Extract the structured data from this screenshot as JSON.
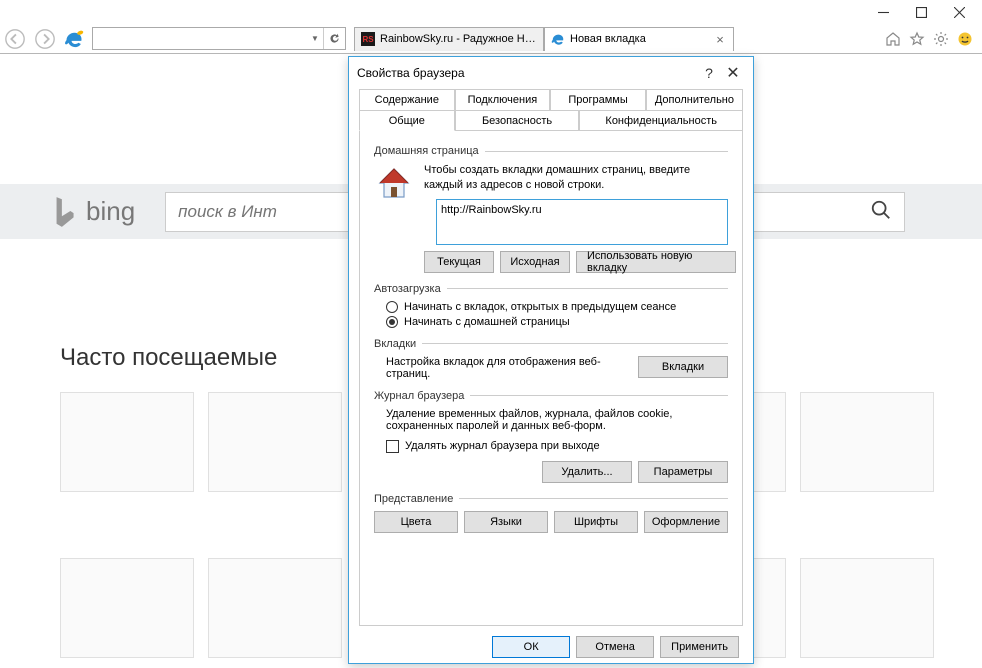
{
  "window": {
    "minimize": "",
    "maximize": "",
    "close": ""
  },
  "tabs": [
    {
      "label": "RainbowSky.ru - Радужное Не…",
      "type": "rs"
    },
    {
      "label": "Новая вкладка",
      "type": "ie"
    }
  ],
  "toolbar_icons": [
    "home",
    "star",
    "gear",
    "smiley"
  ],
  "page": {
    "bing_label": "bing",
    "search_placeholder": "поиск в Инт",
    "frequent_heading": "Часто посещаемые"
  },
  "dialog": {
    "title": "Свойства браузера",
    "help": "?",
    "close": "✕",
    "tabs_row1": [
      "Содержание",
      "Подключения",
      "Программы",
      "Дополнительно"
    ],
    "tabs_row2": [
      "Общие",
      "Безопасность",
      "Конфиденциальность"
    ],
    "active_tab": "Общие",
    "homepage": {
      "title": "Домашняя страница",
      "desc": "Чтобы создать вкладки домашних страниц, введите каждый из адресов с новой строки.",
      "value": "http://RainbowSky.ru",
      "btn_current": "Текущая",
      "btn_default": "Исходная",
      "btn_newtab": "Использовать новую вкладку"
    },
    "startup": {
      "title": "Автозагрузка",
      "opt1": "Начинать с вкладок, открытых в предыдущем сеансе",
      "opt2": "Начинать с домашней страницы",
      "selected": 1
    },
    "tabs_section": {
      "title": "Вкладки",
      "desc": "Настройка вкладок для отображения веб-страниц.",
      "btn": "Вкладки"
    },
    "history": {
      "title": "Журнал браузера",
      "desc": "Удаление временных файлов, журнала, файлов cookie, сохраненных паролей и данных веб-форм.",
      "check": "Удалять журнал браузера при выходе",
      "btn_delete": "Удалить...",
      "btn_params": "Параметры"
    },
    "appearance": {
      "title": "Представление",
      "btn_colors": "Цвета",
      "btn_langs": "Языки",
      "btn_fonts": "Шрифты",
      "btn_style": "Оформление"
    },
    "footer": {
      "ok": "ОК",
      "cancel": "Отмена",
      "apply": "Применить"
    }
  }
}
